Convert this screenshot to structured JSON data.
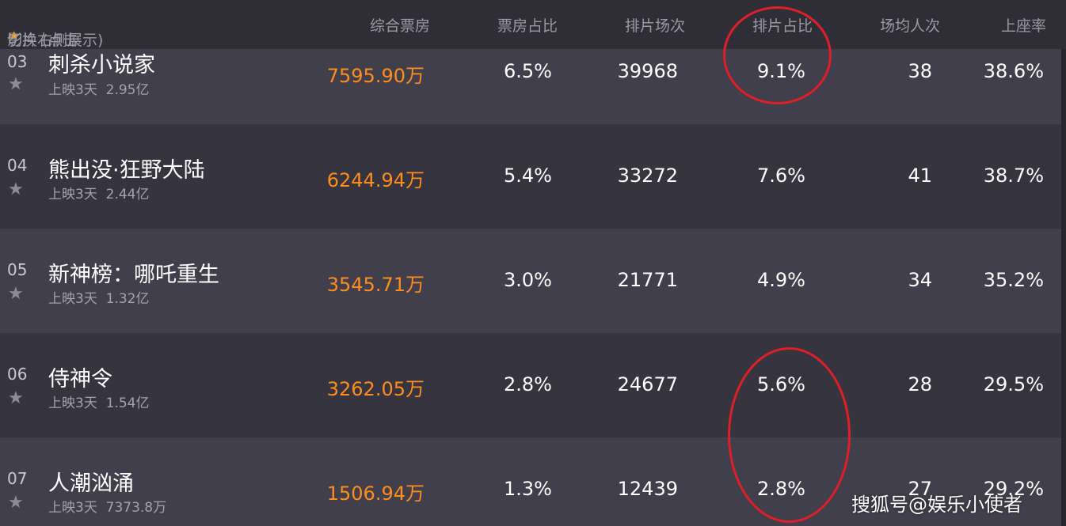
{
  "header": {
    "film_prefix": "影片 (点击",
    "film_suffix": "切换右侧展示)",
    "box_office": "综合票房",
    "box_share": "票房占比",
    "screenings": "排片场次",
    "screening_share": "排片占比",
    "avg_attendance": "场均人次",
    "occupancy": "上座率"
  },
  "rows": [
    {
      "rank": "03",
      "title": "刺杀小说家",
      "days": "上映3天",
      "total": "2.95亿",
      "box": "7595.90万",
      "box_share": "6.5%",
      "screenings": "39968",
      "screening_share": "9.1%",
      "avg": "38",
      "occupancy": "38.6%"
    },
    {
      "rank": "04",
      "title": "熊出没·狂野大陆",
      "days": "上映3天",
      "total": "2.44亿",
      "box": "6244.94万",
      "box_share": "5.4%",
      "screenings": "33272",
      "screening_share": "7.6%",
      "avg": "41",
      "occupancy": "38.7%"
    },
    {
      "rank": "05",
      "title": "新神榜：哪吒重生",
      "days": "上映3天",
      "total": "1.32亿",
      "box": "3545.71万",
      "box_share": "3.0%",
      "screenings": "21771",
      "screening_share": "4.9%",
      "avg": "34",
      "occupancy": "35.2%"
    },
    {
      "rank": "06",
      "title": "侍神令",
      "days": "上映3天",
      "total": "1.54亿",
      "box": "3262.05万",
      "box_share": "2.8%",
      "screenings": "24677",
      "screening_share": "5.6%",
      "avg": "28",
      "occupancy": "29.5%"
    },
    {
      "rank": "07",
      "title": "人潮汹涌",
      "days": "上映3天",
      "total": "7373.8万",
      "box": "1506.94万",
      "box_share": "1.3%",
      "screenings": "12439",
      "screening_share": "2.8%",
      "avg": "27",
      "occupancy": "29.2%"
    }
  ],
  "watermark": "搜狐号@娱乐小使者",
  "colors": {
    "accent": "#ff8d1e",
    "highlight_circle": "#e01e27",
    "row_light": "#403f4b",
    "row_dark": "#35343f"
  }
}
